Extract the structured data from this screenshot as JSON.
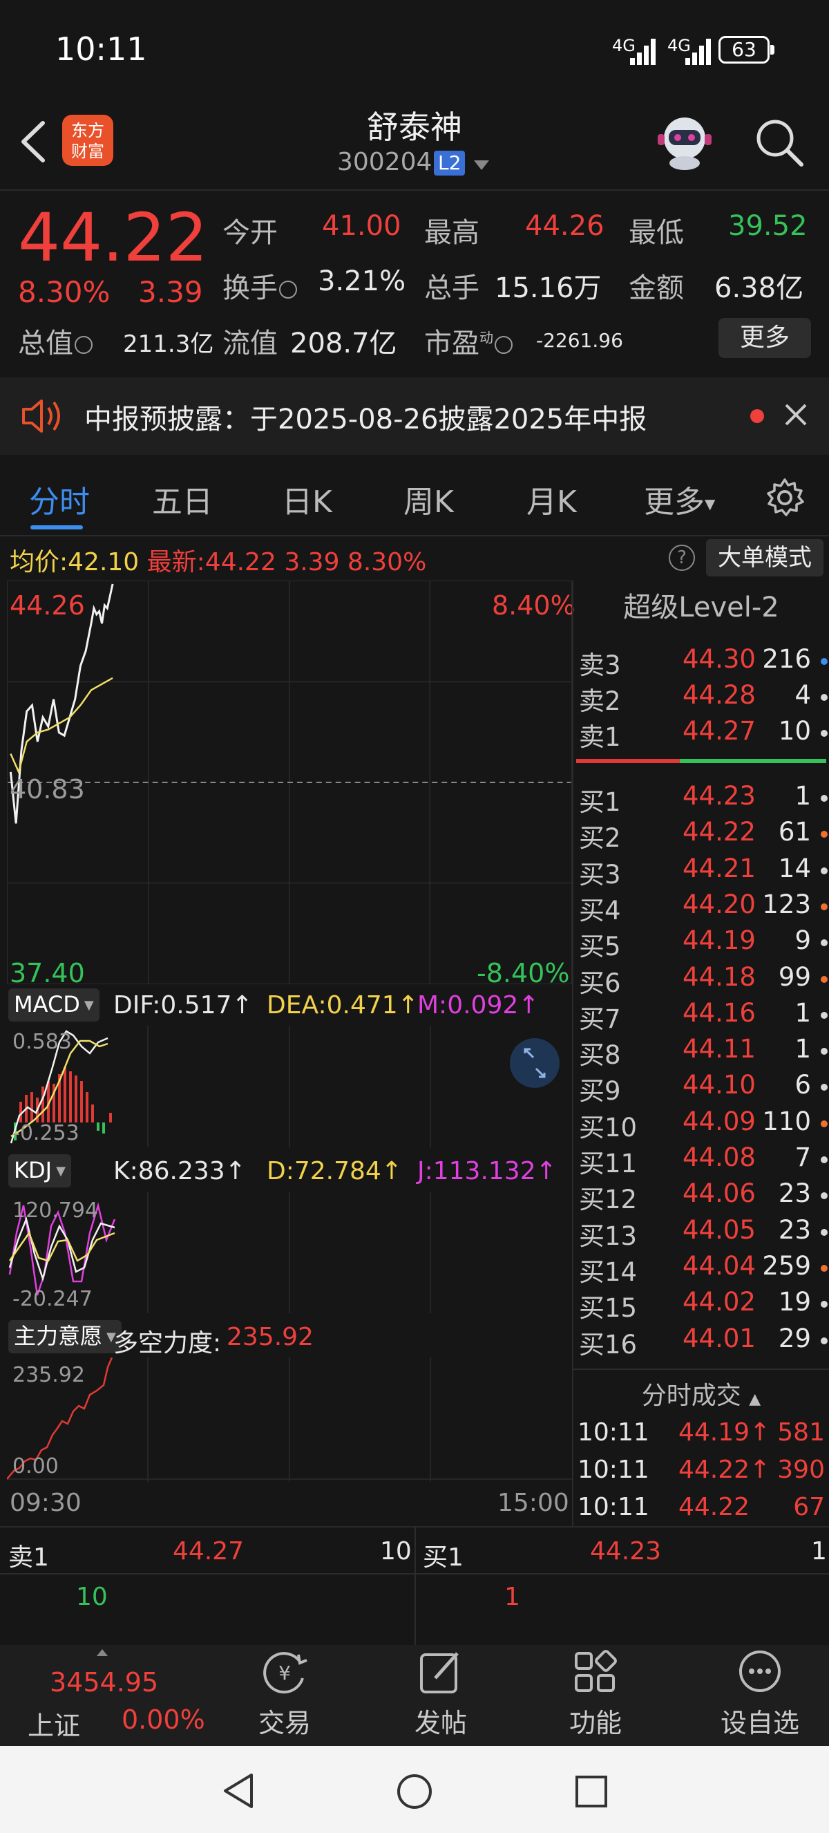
{
  "status_bar": {
    "time": "10:11",
    "sig1": "4G",
    "sig2": "4G",
    "battery": "63"
  },
  "header": {
    "title": "舒泰神",
    "code": "300204",
    "badge": "L2",
    "logo_line1": "东方",
    "logo_line2": "财富"
  },
  "quote": {
    "price": "44.22",
    "pct": "8.30%",
    "change": "3.39",
    "open_label": "今开",
    "open": "41.00",
    "high_label": "最高",
    "high": "44.26",
    "low_label": "最低",
    "low": "39.52",
    "turnover_label": "换手",
    "turnover": "3.21%",
    "volume_label": "总手",
    "volume": "15.16万",
    "amount_label": "金额",
    "amount": "6.38亿",
    "mcap_label": "总值",
    "mcap": "211.3亿",
    "float_label": "流值",
    "float": "208.7亿",
    "pe_label": "市盈",
    "pe_sup": "动",
    "pe": "-2261.96",
    "more": "更多"
  },
  "notice": {
    "text": "中报预披露：于2025-08-26披露2025年中报"
  },
  "tabs": [
    "分时",
    "五日",
    "日K",
    "周K",
    "月K",
    "更多"
  ],
  "info_line": {
    "avg_label": "均价:",
    "avg": "42.10",
    "latest_label": "最新:",
    "latest": "44.22",
    "chg": "3.39",
    "pct": "8.30%",
    "mode": "大单模式",
    "help": "?"
  },
  "chart": {
    "top_left": "44.26",
    "top_right": "8.40%",
    "mid": "40.83",
    "bottom_left": "37.40",
    "bottom_right": "-8.40%",
    "time_start": "09:30",
    "time_end": "15:00",
    "price_line": [
      [
        0,
        0.62
      ],
      [
        2,
        0.79
      ],
      [
        4,
        0.55
      ],
      [
        6,
        0.42
      ],
      [
        8,
        0.4
      ],
      [
        10,
        0.52
      ],
      [
        12,
        0.44
      ],
      [
        14,
        0.47
      ],
      [
        16,
        0.38
      ],
      [
        18,
        0.49
      ],
      [
        20,
        0.5
      ],
      [
        22,
        0.44
      ],
      [
        24,
        0.38
      ],
      [
        26,
        0.27
      ],
      [
        28,
        0.22
      ],
      [
        30,
        0.13
      ],
      [
        31,
        0.08
      ],
      [
        32,
        0.1
      ],
      [
        33,
        0.09
      ],
      [
        34,
        0.13
      ],
      [
        35,
        0.07
      ],
      [
        36,
        0.08
      ],
      [
        37,
        0.04
      ],
      [
        38,
        0.0
      ]
    ],
    "avg_line": [
      [
        0,
        0.56
      ],
      [
        3,
        0.62
      ],
      [
        6,
        0.52
      ],
      [
        10,
        0.49
      ],
      [
        14,
        0.48
      ],
      [
        18,
        0.46
      ],
      [
        22,
        0.44
      ],
      [
        26,
        0.4
      ],
      [
        30,
        0.35
      ],
      [
        34,
        0.33
      ],
      [
        38,
        0.31
      ]
    ]
  },
  "macd": {
    "tag": "MACD",
    "dif": "DIF:0.517↑",
    "dea": "DEA:0.471↑",
    "m": "M:0.092↑",
    "top": "0.583",
    "bottom": "-0.253"
  },
  "kdj": {
    "tag": "KDJ",
    "k": "K:86.233↑",
    "d": "D:72.784↑",
    "j": "J:113.132↑",
    "top": "120.794",
    "bottom": "-20.247"
  },
  "force": {
    "tag": "主力意愿",
    "label": "多空力度:",
    "value": "235.92",
    "top": "235.92",
    "bottom": "0.00"
  },
  "orderbook": {
    "title": "超级Level-2",
    "sells": [
      {
        "label": "卖3",
        "price": "44.30",
        "vol": "216",
        "dot": "#3d8ef0"
      },
      {
        "label": "卖2",
        "price": "44.28",
        "vol": "4",
        "dot": "#d8d8d8"
      },
      {
        "label": "卖1",
        "price": "44.27",
        "vol": "10",
        "dot": "#d8d8d8"
      }
    ],
    "buys": [
      {
        "label": "买1",
        "price": "44.23",
        "vol": "1",
        "dot": "#d8d8d8"
      },
      {
        "label": "买2",
        "price": "44.22",
        "vol": "61",
        "dot": "#f07030"
      },
      {
        "label": "买3",
        "price": "44.21",
        "vol": "14",
        "dot": "#d8d8d8"
      },
      {
        "label": "买4",
        "price": "44.20",
        "vol": "123",
        "dot": "#f07030"
      },
      {
        "label": "买5",
        "price": "44.19",
        "vol": "9",
        "dot": "#d8d8d8"
      },
      {
        "label": "买6",
        "price": "44.18",
        "vol": "99",
        "dot": "#f07030"
      },
      {
        "label": "买7",
        "price": "44.16",
        "vol": "1",
        "dot": "#d8d8d8"
      },
      {
        "label": "买8",
        "price": "44.11",
        "vol": "1",
        "dot": "#d8d8d8"
      },
      {
        "label": "买9",
        "price": "44.10",
        "vol": "6",
        "dot": "#d8d8d8"
      },
      {
        "label": "买10",
        "price": "44.09",
        "vol": "110",
        "dot": "#f07030"
      },
      {
        "label": "买11",
        "price": "44.08",
        "vol": "7",
        "dot": "#d8d8d8"
      },
      {
        "label": "买12",
        "price": "44.06",
        "vol": "23",
        "dot": "#d8d8d8"
      },
      {
        "label": "买13",
        "price": "44.05",
        "vol": "23",
        "dot": "#d8d8d8"
      },
      {
        "label": "买14",
        "price": "44.04",
        "vol": "259",
        "dot": "#f07030"
      },
      {
        "label": "买15",
        "price": "44.02",
        "vol": "19",
        "dot": "#d8d8d8"
      },
      {
        "label": "买16",
        "price": "44.01",
        "vol": "29",
        "dot": "#d8d8d8"
      }
    ],
    "trades_title": "分时成交",
    "trades": [
      {
        "time": "10:11",
        "price": "44.19↑",
        "vol": "581"
      },
      {
        "time": "10:11",
        "price": "44.22↑",
        "vol": "390"
      },
      {
        "time": "10:11",
        "price": "44.22",
        "vol": "67"
      }
    ]
  },
  "bidask": {
    "sell_label": "卖1",
    "sell_price": "44.27",
    "sell_vol": "10",
    "sell_sub": "10",
    "buy_label": "买1",
    "buy_price": "44.23",
    "buy_vol": "1",
    "buy_sub": "1"
  },
  "nav": {
    "index_value": "3454.95",
    "index_name": "上证",
    "index_pct": "0.00%",
    "items": [
      "交易",
      "发帖",
      "功能",
      "设自选"
    ]
  }
}
